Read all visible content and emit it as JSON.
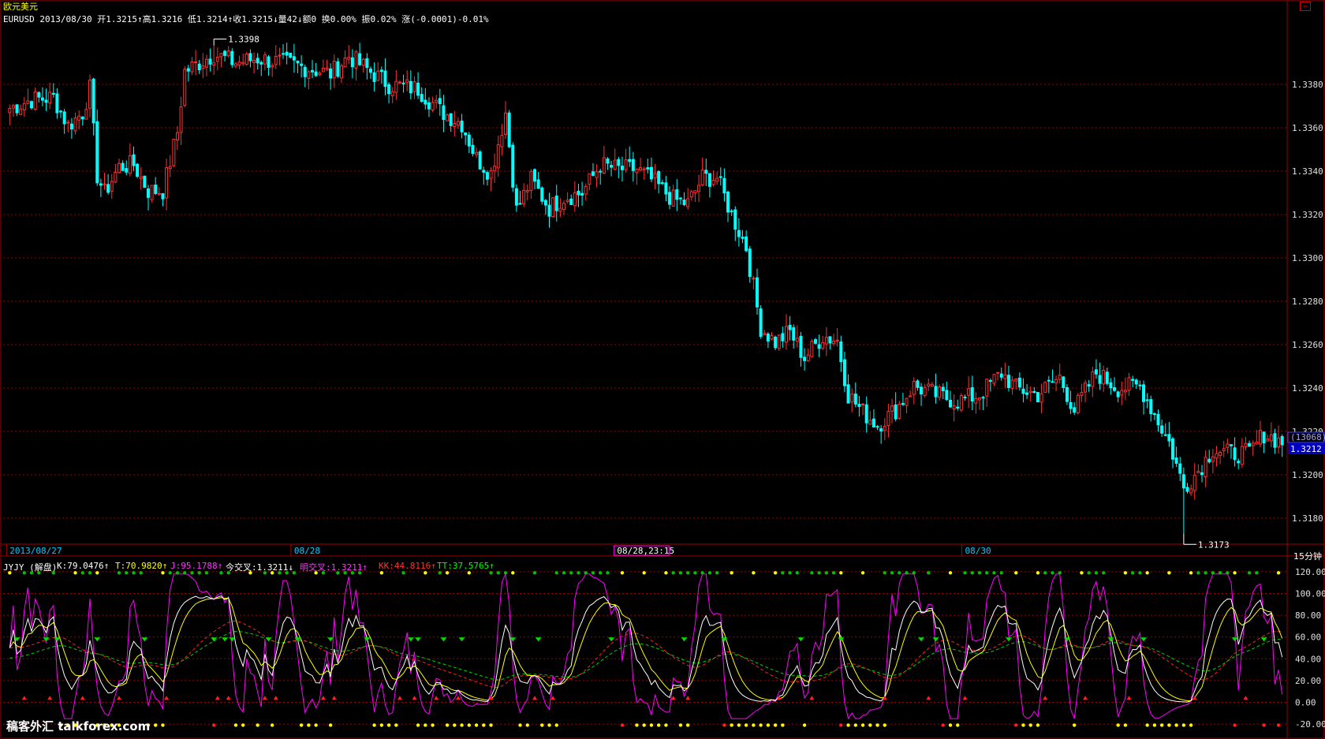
{
  "header": {
    "symbol_cn": "欧元美元",
    "quote_line": "EURUSD 2013/08/30 开1.3215↑高1.3216 低1.3214↑收1.3215↓量42↓额0 换0.00% 振0.02% 涨(-0.0001)-0.01%"
  },
  "indicator_header": {
    "name": "JYJY (解盘)",
    "k": "K:79.0476↑",
    "t": "T:70.9820↑",
    "j": "J:95.1788↑",
    "jcx": "今交叉:1.3211↓",
    "mjc": "明交叉:1.3211↑",
    "kk": "KK:44.8116↑",
    "tt": "TT:37.5765↑"
  },
  "timeframe": "15分钟",
  "watermark": "稿客外汇 talkforex.com",
  "price_panel": {
    "high_label": "1.3398",
    "low_label": "1.3173",
    "current_count": "(13068)",
    "current_price": "1.3212"
  },
  "colors": {
    "up_candle": "#ff3030",
    "down_candle": "#00ffff",
    "grid": "#a00000",
    "k_line": "#ffffff",
    "t_line": "#ffff00",
    "j_line": "#ff00ff",
    "kk_line": "#ff2020",
    "tt_line": "#00d000"
  },
  "chart_data": [
    {
      "type": "candlestick",
      "title": "EURUSD 15分钟",
      "yticks": [
        1.318,
        1.32,
        1.322,
        1.324,
        1.326,
        1.328,
        1.33,
        1.332,
        1.334,
        1.336,
        1.338
      ],
      "ylim": [
        1.3168,
        1.3408
      ],
      "x_labels": [
        {
          "label": "2013/08/27",
          "index": 0
        },
        {
          "label": "08/28",
          "index": 78
        },
        {
          "label": "08/28,23:15",
          "index": 167
        },
        {
          "label": "08/30",
          "index": 262
        }
      ],
      "bar_count": 350,
      "anchors": [
        [
          0,
          1.3369
        ],
        [
          6,
          1.3373
        ],
        [
          12,
          1.3374
        ],
        [
          16,
          1.3361
        ],
        [
          20,
          1.3367
        ],
        [
          22,
          1.3378
        ],
        [
          24,
          1.3338
        ],
        [
          26,
          1.333
        ],
        [
          30,
          1.3342
        ],
        [
          34,
          1.3343
        ],
        [
          38,
          1.3331
        ],
        [
          42,
          1.3331
        ],
        [
          46,
          1.3358
        ],
        [
          48,
          1.3386
        ],
        [
          52,
          1.339
        ],
        [
          56,
          1.3394
        ],
        [
          62,
          1.339
        ],
        [
          68,
          1.3392
        ],
        [
          78,
          1.3389
        ],
        [
          88,
          1.3385
        ],
        [
          93,
          1.3393
        ],
        [
          98,
          1.3387
        ],
        [
          104,
          1.338
        ],
        [
          112,
          1.3378
        ],
        [
          118,
          1.3368
        ],
        [
          124,
          1.3362
        ],
        [
          128,
          1.3346
        ],
        [
          132,
          1.3339
        ],
        [
          136,
          1.3367
        ],
        [
          139,
          1.3322
        ],
        [
          143,
          1.3336
        ],
        [
          148,
          1.3323
        ],
        [
          152,
          1.3328
        ],
        [
          157,
          1.333
        ],
        [
          162,
          1.3343
        ],
        [
          167,
          1.3341
        ],
        [
          172,
          1.3341
        ],
        [
          176,
          1.3336
        ],
        [
          182,
          1.3327
        ],
        [
          186,
          1.3325
        ],
        [
          190,
          1.3337
        ],
        [
          194,
          1.3337
        ],
        [
          198,
          1.332
        ],
        [
          202,
          1.3305
        ],
        [
          206,
          1.3268
        ],
        [
          210,
          1.3261
        ],
        [
          214,
          1.3266
        ],
        [
          218,
          1.3254
        ],
        [
          223,
          1.3264
        ],
        [
          227,
          1.3262
        ],
        [
          230,
          1.3237
        ],
        [
          234,
          1.3229
        ],
        [
          238,
          1.3223
        ],
        [
          243,
          1.323
        ],
        [
          248,
          1.3241
        ],
        [
          254,
          1.3237
        ],
        [
          260,
          1.3234
        ],
        [
          266,
          1.3237
        ],
        [
          272,
          1.3247
        ],
        [
          276,
          1.324
        ],
        [
          282,
          1.3237
        ],
        [
          288,
          1.3245
        ],
        [
          292,
          1.323
        ],
        [
          298,
          1.3247
        ],
        [
          304,
          1.324
        ],
        [
          310,
          1.3241
        ],
        [
          314,
          1.3228
        ],
        [
          318,
          1.3215
        ],
        [
          322,
          1.3194
        ],
        [
          326,
          1.3202
        ],
        [
          330,
          1.3212
        ],
        [
          334,
          1.321
        ],
        [
          340,
          1.321
        ],
        [
          344,
          1.3219
        ],
        [
          349,
          1.3215
        ]
      ],
      "extremes": [
        {
          "index": 56,
          "value": 1.3398,
          "label": "1.3398"
        },
        {
          "index": 322,
          "value": 1.3173,
          "label": "1.3173"
        }
      ]
    },
    {
      "type": "line",
      "title": "JYJY (解盘)",
      "yticks": [
        -20,
        0,
        20,
        40,
        60,
        80,
        100,
        120
      ],
      "ylim": [
        -25,
        125
      ],
      "series": [
        {
          "name": "K",
          "value_last": 79.0476
        },
        {
          "name": "T",
          "value_last": 70.982
        },
        {
          "name": "J",
          "value_last": 95.1788
        },
        {
          "name": "KK",
          "value_last": 44.8116
        },
        {
          "name": "TT",
          "value_last": 37.5765
        }
      ]
    }
  ]
}
